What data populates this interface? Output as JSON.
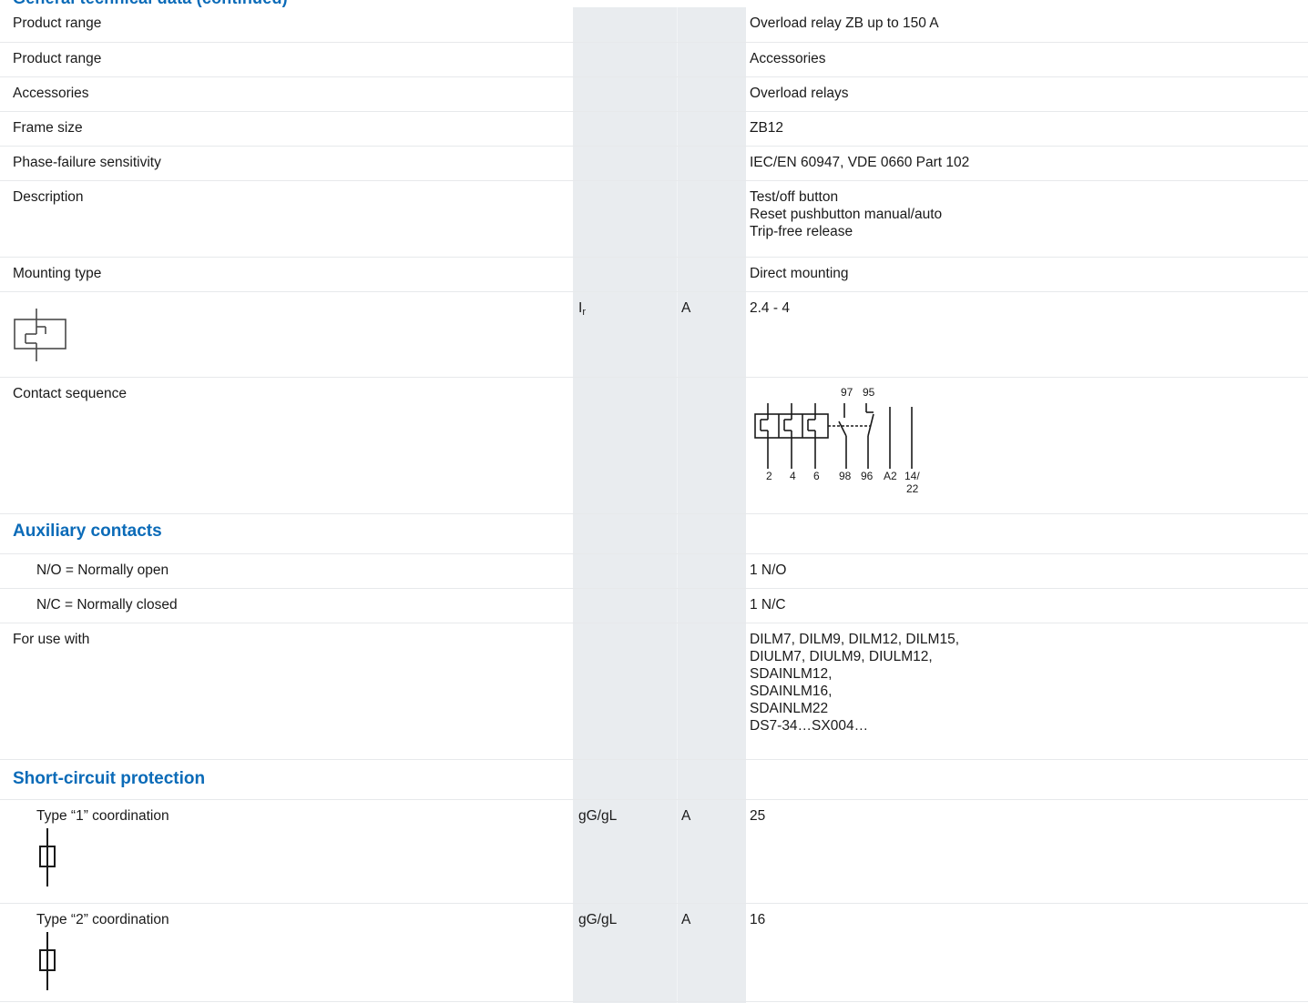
{
  "header_clipped_title": "General technical data (continued)",
  "rows": [
    {
      "label": "Product range",
      "value": "Overload relay ZB up to 150 A"
    },
    {
      "label": "Product range",
      "value": "Accessories"
    },
    {
      "label": "Accessories",
      "value": "Overload relays"
    },
    {
      "label": "Frame size",
      "value": "ZB12"
    },
    {
      "label": "Phase-failure sensitivity",
      "value": "IEC/EN 60947, VDE 0660 Part 102"
    },
    {
      "label": "Description",
      "lines": [
        "Test/off button",
        "Reset pushbutton manual/auto",
        "Trip-free release"
      ]
    },
    {
      "label": "Mounting type",
      "value": "Direct mounting"
    }
  ],
  "current_row": {
    "icon": "thermal-overload-icon",
    "symbol": "I",
    "symbol_sub": "r",
    "unit": "A",
    "value": "2.4 - 4"
  },
  "contact_sequence": {
    "label": "Contact sequence",
    "top_labels": [
      "97",
      "95"
    ],
    "bottom_labels": [
      "2",
      "4",
      "6",
      "98",
      "96",
      "A2",
      "14/",
      "22"
    ]
  },
  "auxiliary": {
    "title": "Auxiliary contacts",
    "no_label": "N/O = Normally open",
    "no_value": "1 N/O",
    "nc_label": "N/C = Normally closed",
    "nc_value": "1 N/C"
  },
  "for_use_with": {
    "label": "For use with",
    "lines": [
      "DILM7, DILM9, DILM12, DILM15,",
      "DIULM7, DIULM9, DIULM12,",
      "SDAINLM12,",
      "SDAINLM16,",
      "SDAINLM22",
      "DS7-34…SX004…"
    ]
  },
  "short_circuit": {
    "title": "Short-circuit protection",
    "type1": {
      "label": "Type “1” coordination",
      "fuse": "gG/gL",
      "unit": "A",
      "value": "25",
      "icon": "fuse-icon"
    },
    "type2": {
      "label": "Type “2” coordination",
      "fuse": "gG/gL",
      "unit": "A",
      "value": "16",
      "icon": "fuse-icon"
    }
  }
}
